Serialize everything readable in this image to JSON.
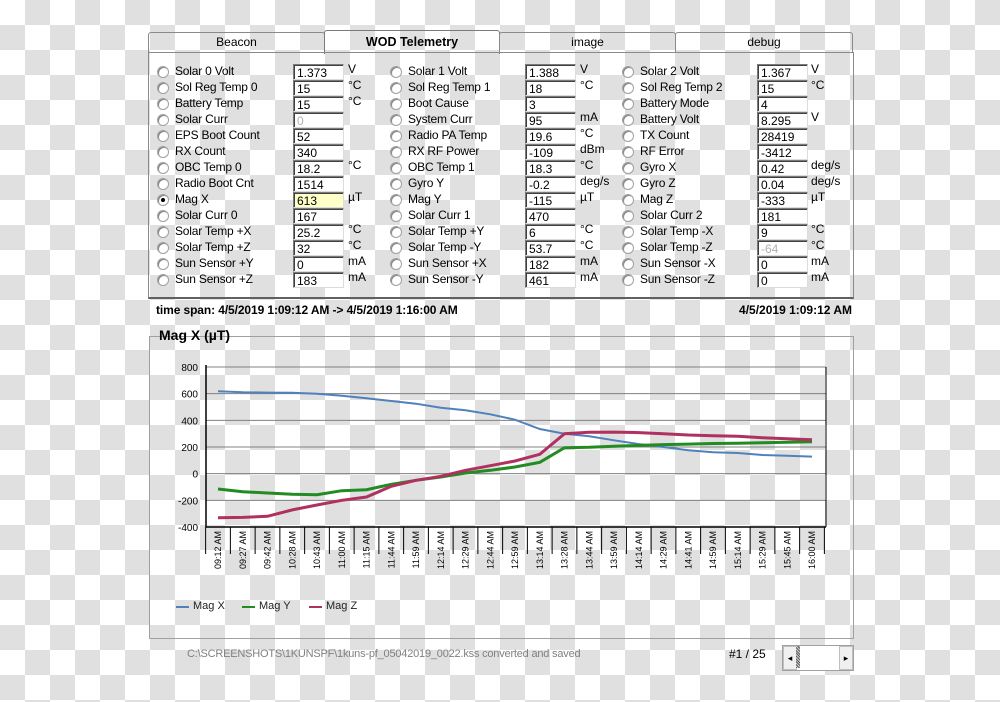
{
  "tabs": [
    {
      "label": "Beacon",
      "active": false
    },
    {
      "label": "WOD Telemetry",
      "active": true
    },
    {
      "label": "image",
      "active": false
    },
    {
      "label": "debug",
      "active": false
    }
  ],
  "fields": {
    "col1": [
      {
        "label": "Solar 0 Volt",
        "value": "1.373",
        "unit": "V"
      },
      {
        "label": "Sol Reg Temp 0",
        "value": "15",
        "unit": "°C"
      },
      {
        "label": "Battery Temp",
        "value": "15",
        "unit": "°C"
      },
      {
        "label": "Solar Curr",
        "value": "0",
        "unit": "",
        "disabled": true
      },
      {
        "label": "EPS Boot Count",
        "value": "52",
        "unit": ""
      },
      {
        "label": "RX Count",
        "value": "340",
        "unit": ""
      },
      {
        "label": "OBC Temp 0",
        "value": "18.2",
        "unit": "°C"
      },
      {
        "label": "Radio Boot Cnt",
        "value": "1514",
        "unit": ""
      },
      {
        "label": "Mag X",
        "value": "613",
        "unit": "µT",
        "selected": true
      },
      {
        "label": "Solar Curr 0",
        "value": "167",
        "unit": ""
      },
      {
        "label": "Solar Temp +X",
        "value": "25.2",
        "unit": "°C"
      },
      {
        "label": "Solar Temp +Z",
        "value": "32",
        "unit": "°C"
      },
      {
        "label": "Sun Sensor +Y",
        "value": "0",
        "unit": "mA"
      },
      {
        "label": "Sun Sensor +Z",
        "value": "183",
        "unit": "mA"
      }
    ],
    "col2": [
      {
        "label": "Solar 1 Volt",
        "value": "1.388",
        "unit": "V"
      },
      {
        "label": "Sol Reg Temp 1",
        "value": "18",
        "unit": "°C"
      },
      {
        "label": "Boot Cause",
        "value": "3",
        "unit": ""
      },
      {
        "label": "System Curr",
        "value": "95",
        "unit": "mA"
      },
      {
        "label": "Radio PA Temp",
        "value": "19.6",
        "unit": "°C"
      },
      {
        "label": "RX RF Power",
        "value": "-109",
        "unit": "dBm"
      },
      {
        "label": "OBC Temp 1",
        "value": "18.3",
        "unit": "°C"
      },
      {
        "label": "Gyro Y",
        "value": "-0.2",
        "unit": "deg/s"
      },
      {
        "label": "Mag Y",
        "value": "-115",
        "unit": "µT"
      },
      {
        "label": "Solar Curr 1",
        "value": "470",
        "unit": ""
      },
      {
        "label": "Solar Temp +Y",
        "value": "6",
        "unit": "°C"
      },
      {
        "label": "Solar Temp -Y",
        "value": "53.7",
        "unit": "°C"
      },
      {
        "label": "Sun Sensor +X",
        "value": "182",
        "unit": "mA"
      },
      {
        "label": "Sun Sensor -Y",
        "value": "461",
        "unit": "mA"
      }
    ],
    "col3": [
      {
        "label": "Solar 2 Volt",
        "value": "1.367",
        "unit": "V"
      },
      {
        "label": "Sol Reg Temp 2",
        "value": "15",
        "unit": "°C"
      },
      {
        "label": "Battery Mode",
        "value": "4",
        "unit": ""
      },
      {
        "label": "Battery Volt",
        "value": "8.295",
        "unit": "V"
      },
      {
        "label": "TX Count",
        "value": "28419",
        "unit": ""
      },
      {
        "label": "RF Error",
        "value": "-3412",
        "unit": ""
      },
      {
        "label": "Gyro X",
        "value": "0.42",
        "unit": "deg/s"
      },
      {
        "label": "Gyro Z",
        "value": "0.04",
        "unit": "deg/s"
      },
      {
        "label": "Mag Z",
        "value": "-333",
        "unit": "µT"
      },
      {
        "label": "Solar Curr 2",
        "value": "181",
        "unit": ""
      },
      {
        "label": "Solar Temp -X",
        "value": "9",
        "unit": "°C"
      },
      {
        "label": "Solar Temp -Z",
        "value": "-64",
        "unit": "°C",
        "disabled": true
      },
      {
        "label": "Sun Sensor -X",
        "value": "0",
        "unit": "mA"
      },
      {
        "label": "Sun Sensor -Z",
        "value": "0",
        "unit": "mA"
      }
    ]
  },
  "timespan": "time span: 4/5/2019 1:09:12 AM -> 4/5/2019 1:16:00 AM",
  "current_time": "4/5/2019 1:09:12 AM",
  "chart_title": "Mag X (µT)",
  "status": {
    "message": "C:\\SCREENSHOTS\\1KUNSPF\\1kuns-pf_05042019_0022.kss converted and saved",
    "page": "#1 / 25",
    "scroll_left_icon": "◂",
    "scroll_right_icon": "▸"
  },
  "chart_data": {
    "type": "line",
    "title": "Mag X (µT)",
    "xlabel": "",
    "ylabel": "",
    "ylim": [
      -400,
      800
    ],
    "yticks": [
      800,
      600,
      400,
      200,
      0,
      -200,
      -400
    ],
    "grid": true,
    "legend_position": "bottom-left",
    "categories": [
      "09:12 AM",
      "09:27 AM",
      "09:42 AM",
      "10:28 AM",
      "10:43 AM",
      "11:00 AM",
      "11:15 AM",
      "11:44 AM",
      "11:59 AM",
      "12:14 AM",
      "12:29 AM",
      "12:44 AM",
      "12:59 AM",
      "13:14 AM",
      "13:28 AM",
      "13:44 AM",
      "13:59 AM",
      "14:14 AM",
      "14:29 AM",
      "14:41 AM",
      "14:59 AM",
      "15:14 AM",
      "15:29 AM",
      "15:45 AM",
      "16:00 AM"
    ],
    "series": [
      {
        "name": "Mag X",
        "color": "#4f81bd",
        "values": [
          618,
          610,
          608,
          607,
          600,
          585,
          565,
          545,
          525,
          495,
          475,
          445,
          405,
          335,
          300,
          280,
          250,
          222,
          200,
          175,
          160,
          155,
          140,
          135,
          128
        ]
      },
      {
        "name": "Mag Y",
        "color": "#228b22",
        "values": [
          -115,
          -135,
          -145,
          -155,
          -158,
          -128,
          -120,
          -80,
          -50,
          -25,
          5,
          25,
          50,
          85,
          195,
          198,
          205,
          212,
          218,
          222,
          226,
          228,
          232,
          236,
          240
        ]
      },
      {
        "name": "Mag Z",
        "color": "#b03060",
        "values": [
          -330,
          -328,
          -320,
          -272,
          -235,
          -200,
          -175,
          -95,
          -50,
          -20,
          25,
          60,
          95,
          145,
          300,
          310,
          312,
          308,
          300,
          290,
          285,
          280,
          270,
          262,
          255
        ]
      }
    ]
  }
}
